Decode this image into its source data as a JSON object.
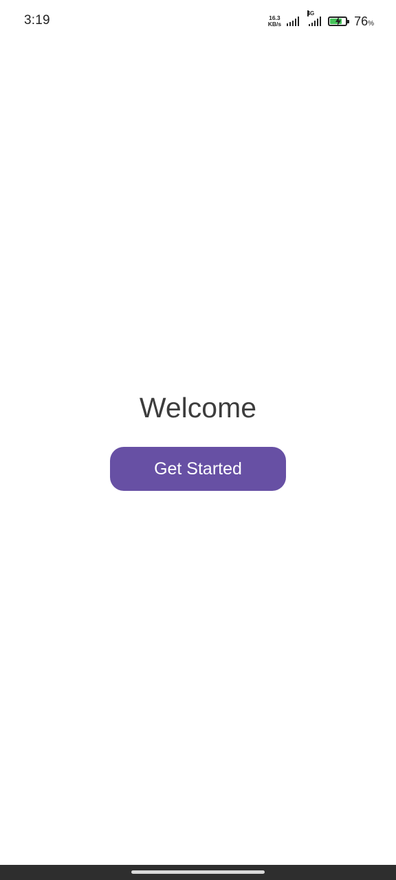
{
  "status_bar": {
    "time": "3:19",
    "net_speed_value": "16.3",
    "net_speed_unit": "KB/s",
    "network_type": "4G",
    "battery_level": 76,
    "battery_percent_value": "76",
    "battery_percent_sign": "%",
    "battery_charging": true,
    "battery_color": "#46c35a"
  },
  "main": {
    "title": "Welcome",
    "get_started_label": "Get Started",
    "accent_color": "#6750a4"
  }
}
